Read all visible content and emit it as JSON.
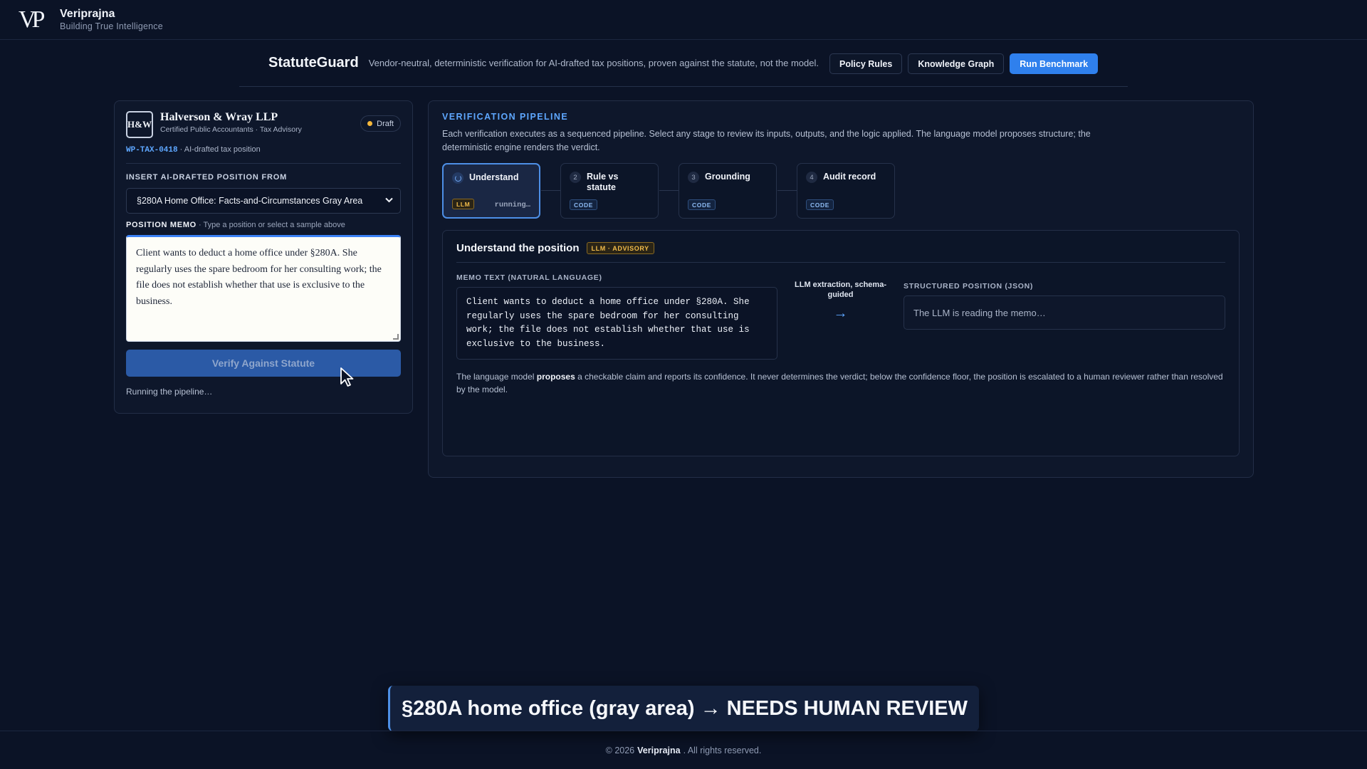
{
  "brand": {
    "logo": "VP",
    "name": "Veriprajna",
    "tagline": "Building True Intelligence"
  },
  "header": {
    "title": "StatuteGuard",
    "description": "Vendor-neutral, deterministic verification for AI-drafted tax positions, proven against the statute, not the model.",
    "buttons": {
      "policy_rules": "Policy Rules",
      "knowledge_graph": "Knowledge Graph",
      "run_benchmark": "Run Benchmark"
    }
  },
  "firm": {
    "logo": "H&W",
    "name": "Halverson & Wray LLP",
    "subtitle": "Certified Public Accountants · Tax Advisory",
    "status": "Draft",
    "ref_id": "WP-TAX-0418",
    "ref_desc": " · AI-drafted tax position"
  },
  "insert": {
    "label": "INSERT AI-DRAFTED POSITION FROM",
    "selected": "§280A Home Office: Facts-and-Circumstances Gray Area"
  },
  "memo": {
    "label": "POSITION MEMO",
    "hint": " · Type a position or select a sample above",
    "text": "Client wants to deduct a home office under §280A. She regularly uses the spare bedroom for her consulting work; the file does not establish whether that use is exclusive to the business."
  },
  "verify_button": "Verify Against Statute",
  "status_text": "Running the pipeline…",
  "pipeline": {
    "title": "VERIFICATION PIPELINE",
    "description": "Each verification executes as a sequenced pipeline. Select any stage to review its inputs, outputs, and the logic applied. The language model proposes structure; the deterministic engine renders the verdict.",
    "stages": [
      {
        "num": "",
        "name": "Understand",
        "tag": "LLM",
        "status": "running…"
      },
      {
        "num": "2",
        "name": "Rule vs statute",
        "tag": "CODE",
        "status": ""
      },
      {
        "num": "3",
        "name": "Grounding",
        "tag": "CODE",
        "status": ""
      },
      {
        "num": "4",
        "name": "Audit record",
        "tag": "CODE",
        "status": ""
      }
    ]
  },
  "detail": {
    "title": "Understand the position",
    "badge": "LLM · ADVISORY",
    "memo_label": "MEMO TEXT (NATURAL LANGUAGE)",
    "memo_text": "Client wants to deduct a home office under §280A. She regularly uses the spare bedroom for her consulting work; the file does not establish whether that use is exclusive to the business.",
    "arrow_label": "LLM extraction, schema-guided",
    "arrow": "→",
    "json_label": "STRUCTURED POSITION (JSON)",
    "json_placeholder": "The LLM is reading the memo…",
    "note_pre": "The language model ",
    "note_bold": "proposes",
    "note_post": " a checkable claim and reports its confidence. It never determines the verdict; below the confidence floor, the position is escalated to a human reviewer rather than resolved by the model."
  },
  "banner": "§280A home office (gray area) → NEEDS HUMAN REVIEW",
  "footer": {
    "pre": "© 2026",
    "brand": "Veriprajna",
    "post": ". All rights reserved."
  },
  "colors": {
    "accent": "#2f80ed",
    "link": "#5ea7ff",
    "llm_tag": "#f2bc4a",
    "draft_dot": "#f5b73b",
    "background": "#0b1326"
  }
}
